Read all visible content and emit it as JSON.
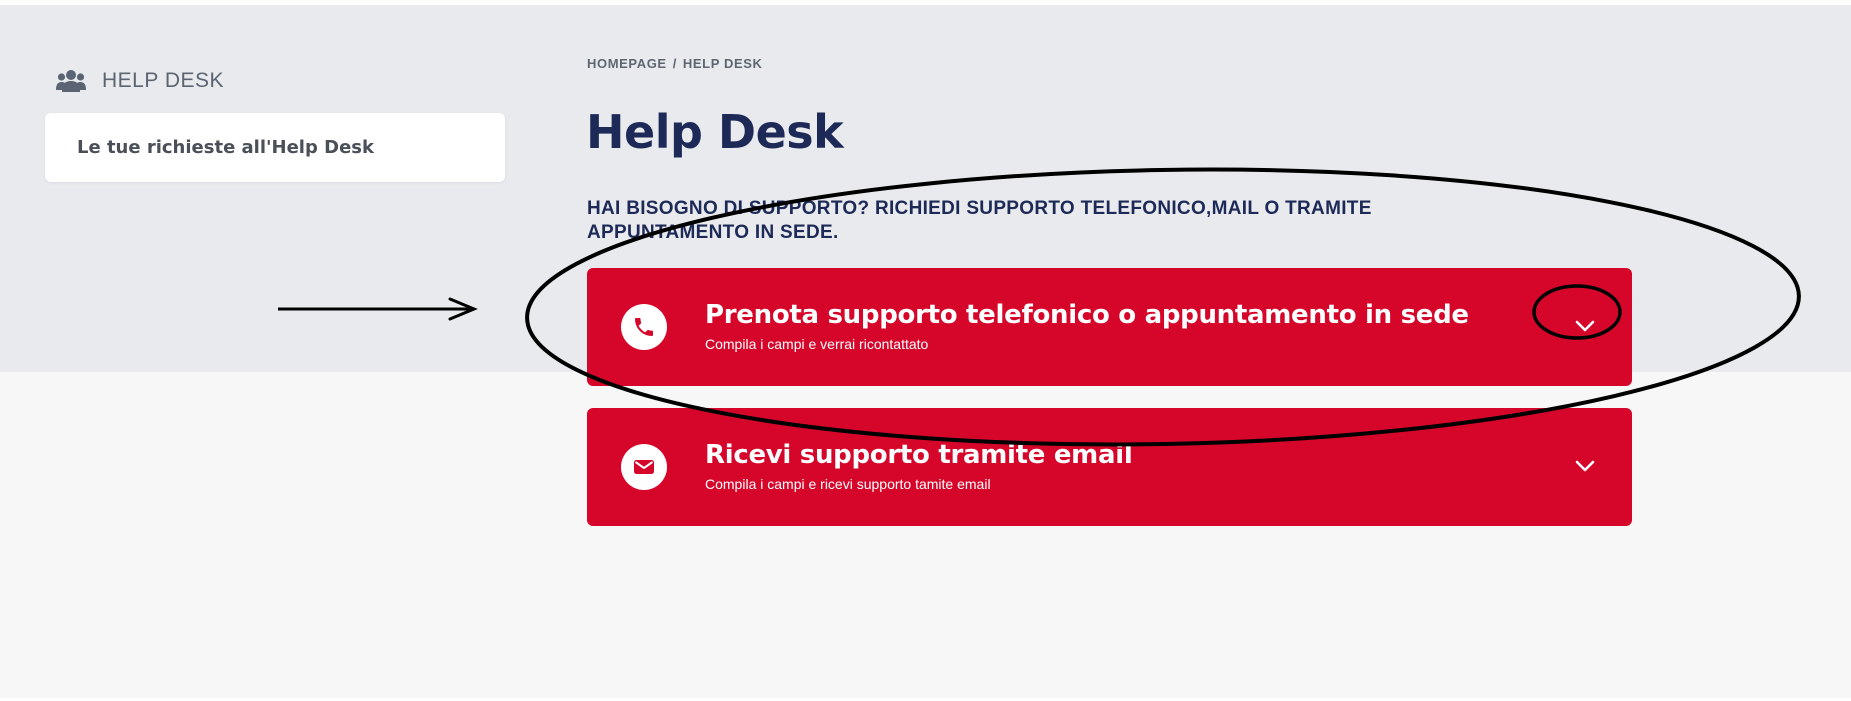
{
  "sidebar": {
    "header_title": "HELP DESK",
    "header_icon": "users-icon",
    "items": [
      {
        "label": "Le tue richieste all'Help Desk"
      }
    ]
  },
  "breadcrumb": {
    "home": "HOMEPAGE",
    "separator": "/",
    "current": "HELP DESK"
  },
  "main": {
    "title": "Help Desk",
    "subtitle": "HAI BISOGNO DI SUPPORTO? RICHIEDI SUPPORTO TELEFONICO,MAIL O TRAMITE APPUNTAMENTO IN SEDE."
  },
  "accordions": [
    {
      "title": "Prenota supporto telefonico o appuntamento in sede",
      "subtitle": "Compila i campi e verrai ricontattato",
      "icon": "phone-icon",
      "expand_icon": "chevron-down-icon"
    },
    {
      "title": "Ricevi supporto tramite email",
      "subtitle": "Compila i campi e ricevi supporto tamite email",
      "icon": "envelope-icon",
      "expand_icon": "chevron-down-icon"
    }
  ],
  "colors": {
    "accent_red": "#d6062b",
    "title_navy": "#1d2a57",
    "band_gray": "#e9eaed",
    "page_bg": "#f7f7f7"
  },
  "annotations": {
    "arrow": "pointing-arrow",
    "ellipses": [
      "highlight-first-card-ellipse",
      "highlight-chevron-ellipse"
    ]
  }
}
